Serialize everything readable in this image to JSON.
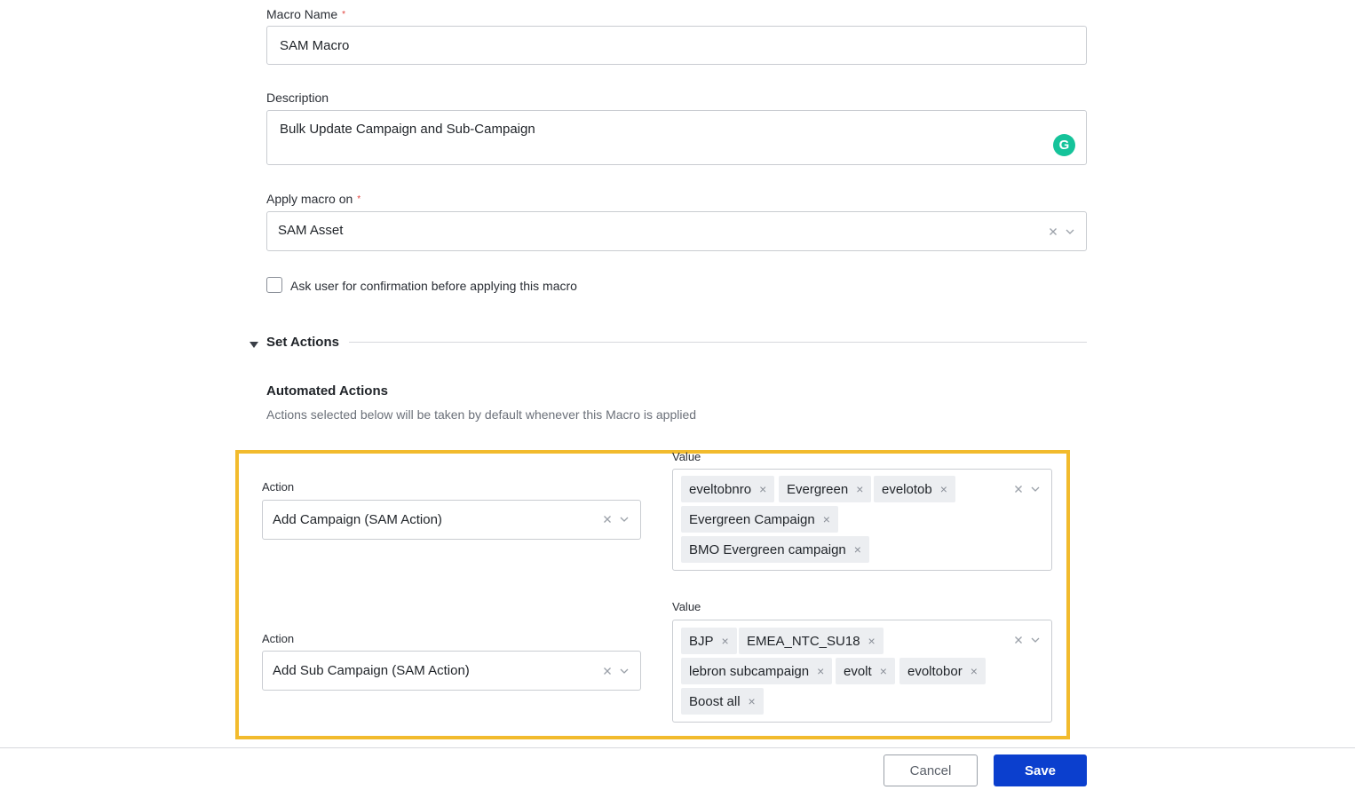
{
  "form": {
    "macro_name": {
      "label": "Macro Name",
      "required_mark": "*",
      "value": "SAM Macro"
    },
    "description": {
      "label": "Description",
      "value": "Bulk Update Campaign and Sub-Campaign"
    },
    "apply_on": {
      "label": "Apply macro on",
      "required_mark": "*",
      "value": "SAM Asset"
    },
    "confirm": {
      "label": "Ask user for confirmation before applying this macro",
      "checked": false
    }
  },
  "set_actions": {
    "title": "Set Actions",
    "automated": {
      "title": "Automated Actions",
      "subtitle": "Actions selected below will be taken by default whenever this Macro is applied"
    },
    "rows": [
      {
        "action_label": "Action",
        "action_value": "Add Campaign (SAM Action)",
        "value_label": "Value",
        "chips": [
          "eveltobnro",
          "Evergreen",
          "evelotob",
          "Evergreen Campaign",
          "BMO Evergreen campaign"
        ]
      },
      {
        "action_label": "Action",
        "action_value": "Add Sub Campaign (SAM Action)",
        "value_label": "Value",
        "chips": [
          "BJP",
          "EMEA_NTC_SU18",
          "lebron subcampaign",
          "evolt",
          "evoltobor",
          "Boost all"
        ]
      }
    ]
  },
  "footer": {
    "cancel_label": "Cancel",
    "save_label": "Save"
  },
  "icons": {
    "clear": "close-icon",
    "dropdown": "chevron-down-icon",
    "collapse": "caret-down-icon",
    "grammarly": "grammarly-icon",
    "chip_remove": "×"
  },
  "colors": {
    "accent": "#0b3fce",
    "highlight": "#f2bb2d",
    "required": "#e0403a",
    "grammarly": "#15c39a"
  }
}
